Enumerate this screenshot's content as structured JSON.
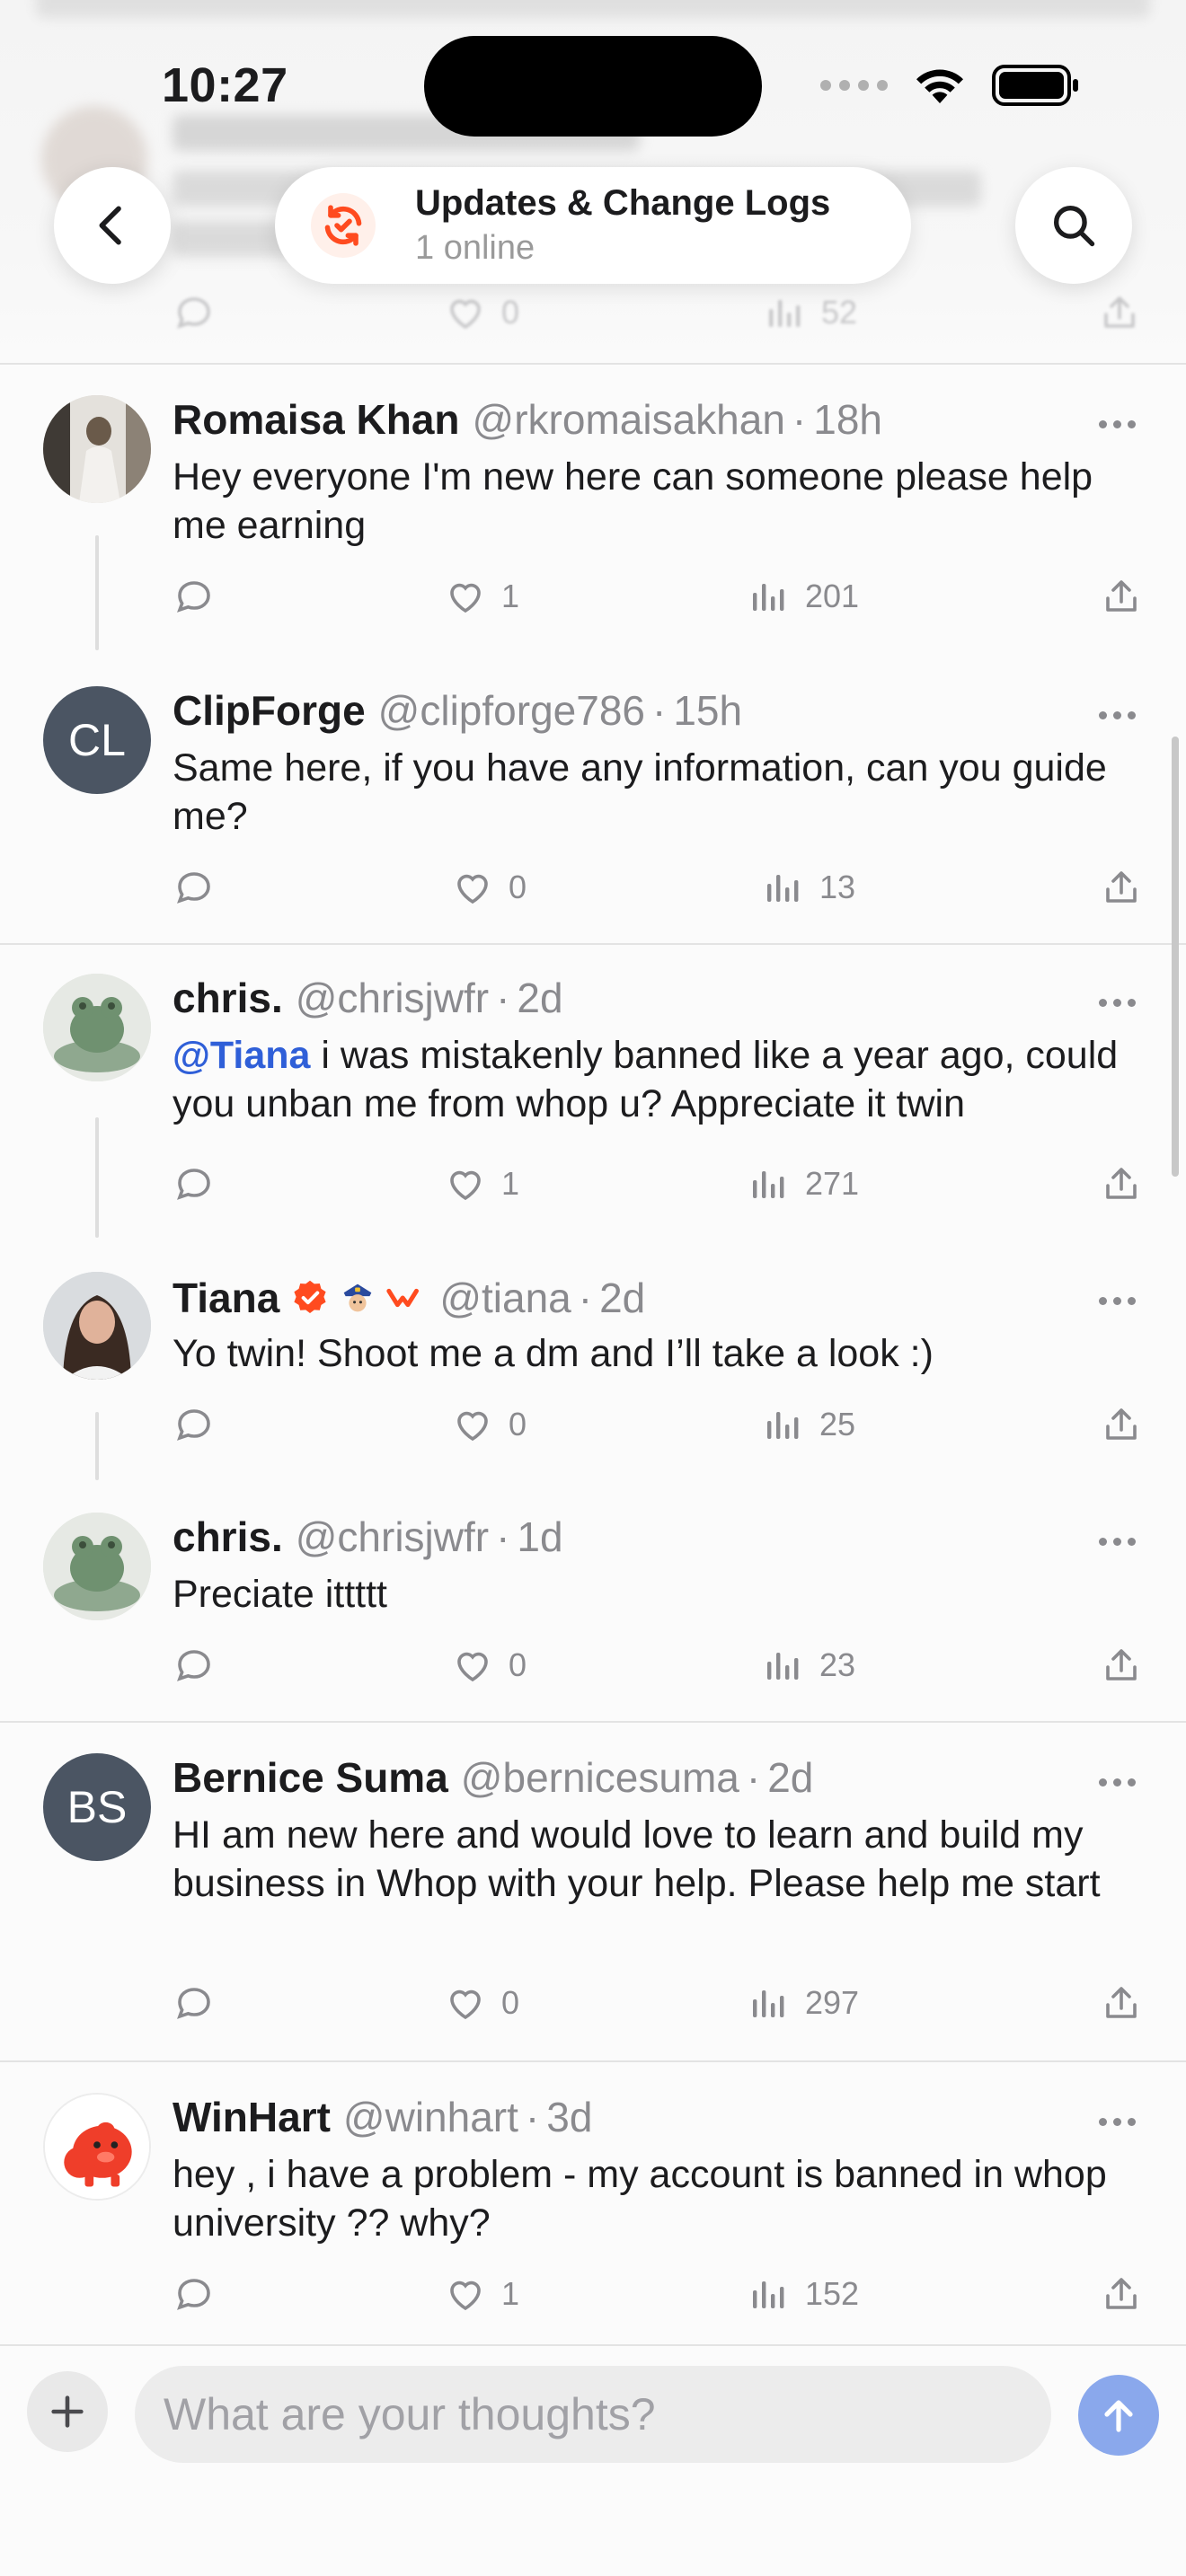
{
  "status_bar": {
    "time": "10:27"
  },
  "header": {
    "channel_title": "Updates & Change Logs",
    "channel_subtitle": "1 online"
  },
  "posts": [
    {
      "name": "Romaisa Khan",
      "handle": "@rkromaisakhan",
      "time": "18h",
      "text": "Hey everyone I'm new here can someone please help me earning",
      "likes": "1",
      "views": "201"
    },
    {
      "name": "ClipForge",
      "handle": "@clipforge786",
      "time": "15h",
      "initials": "CL",
      "text": "Same here, if you have any information, can you guide me?",
      "likes": "0",
      "views": "13"
    },
    {
      "name": "chris.",
      "handle": "@chrisjwfr",
      "time": "2d",
      "mention": "@Tiana",
      "text": " i was mistakenly banned like a year ago, could you unban me from whop u? Appreciate it twin",
      "likes": "1",
      "views": "271"
    },
    {
      "name": "Tiana",
      "handle": "@tiana",
      "time": "2d",
      "text": "Yo twin! Shoot me a dm and I’ll take a look :)",
      "likes": "0",
      "views": "25"
    },
    {
      "name": "chris.",
      "handle": "@chrisjwfr",
      "time": "1d",
      "text": "Preciate ittttt",
      "likes": "0",
      "views": "23"
    },
    {
      "name": "Bernice Suma",
      "handle": "@bernicesuma",
      "time": "2d",
      "initials": "BS",
      "text": "HI am new here and would love to learn and build my business in Whop with your help. Please help me start",
      "likes": "0",
      "views": "297"
    },
    {
      "name": "WinHart",
      "handle": "@winhart",
      "time": "3d",
      "text": "hey , i have a problem - my account is banned in whop university ?? why?",
      "likes": "1",
      "views": "152"
    }
  ],
  "faded_post": {
    "likes": "0",
    "views": "52"
  },
  "composer": {
    "placeholder": "What are your thoughts?"
  },
  "colors": {
    "accent": "#2f5fd8",
    "brand_orange": "#ff4b1f",
    "send": "#8aa8ec"
  },
  "icons": [
    "back-chevron-icon",
    "search-icon",
    "reply-icon",
    "heart-icon",
    "views-icon",
    "share-icon",
    "more-icon",
    "plus-icon",
    "send-arrow-icon",
    "verified-icon"
  ]
}
